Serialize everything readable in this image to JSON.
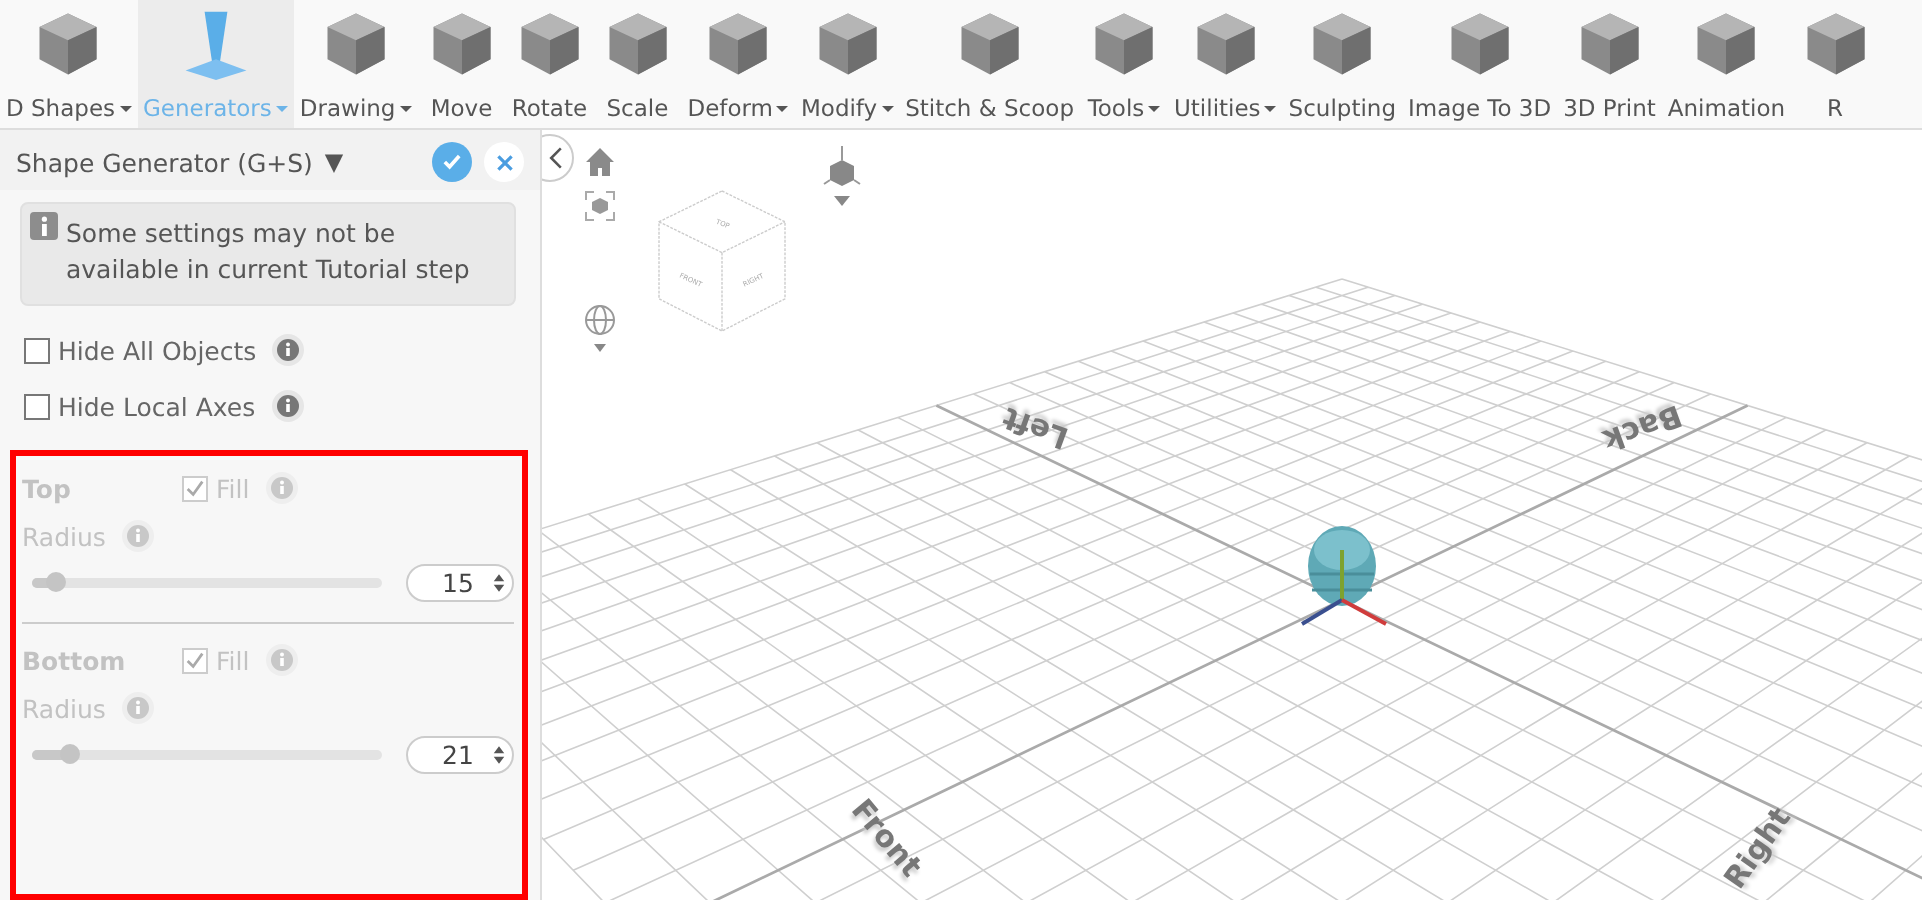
{
  "toolbar": [
    {
      "label": "D Shapes",
      "dropdown": true,
      "selected": false
    },
    {
      "label": "Generators",
      "dropdown": true,
      "selected": true
    },
    {
      "label": "Drawing",
      "dropdown": true,
      "selected": false
    },
    {
      "label": "Move",
      "dropdown": false,
      "selected": false
    },
    {
      "label": "Rotate",
      "dropdown": false,
      "selected": false
    },
    {
      "label": "Scale",
      "dropdown": false,
      "selected": false
    },
    {
      "label": "Deform",
      "dropdown": true,
      "selected": false
    },
    {
      "label": "Modify",
      "dropdown": true,
      "selected": false
    },
    {
      "label": "Stitch & Scoop",
      "dropdown": false,
      "selected": false
    },
    {
      "label": "Tools",
      "dropdown": true,
      "selected": false
    },
    {
      "label": "Utilities",
      "dropdown": true,
      "selected": false
    },
    {
      "label": "Sculpting",
      "dropdown": false,
      "selected": false
    },
    {
      "label": "Image To 3D",
      "dropdown": false,
      "selected": false
    },
    {
      "label": "3D Print",
      "dropdown": false,
      "selected": false
    },
    {
      "label": "Animation",
      "dropdown": false,
      "selected": false
    },
    {
      "label": "R",
      "dropdown": false,
      "selected": false
    }
  ],
  "panel": {
    "title": "Shape Generator (G+S)",
    "title_caret": "▼",
    "notice": "Some settings may not be available in current Tutorial step",
    "options": [
      {
        "label": "Hide All Objects",
        "checked": false
      },
      {
        "label": "Hide Local Axes",
        "checked": false
      }
    ],
    "sections": [
      {
        "title": "Top",
        "disabled": true,
        "fill_label": "Fill",
        "fill_checked": true,
        "radius_label": "Radius",
        "level": 0.07,
        "value": "15"
      },
      {
        "title": "Bottom",
        "disabled": true,
        "fill_label": "Fill",
        "fill_checked": true,
        "radius_label": "Radius",
        "level": 0.11,
        "value": "21"
      }
    ]
  },
  "viewport": {
    "cube_labels": [
      "TOP",
      "FRONT",
      "RIGHT"
    ],
    "floor_labels": [
      {
        "text": "Left",
        "kind": "far-left"
      },
      {
        "text": "Back",
        "kind": "far-right"
      },
      {
        "text": "Front",
        "kind": "near-left"
      },
      {
        "text": "Right",
        "kind": "near-right"
      }
    ]
  }
}
